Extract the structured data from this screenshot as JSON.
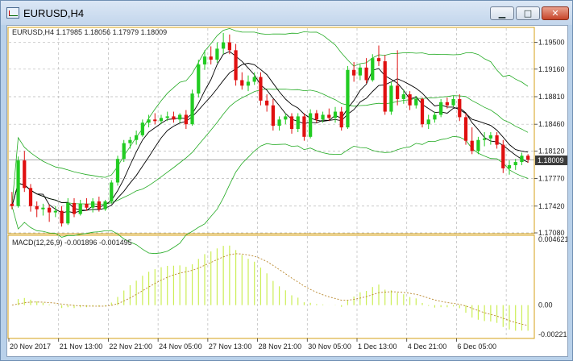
{
  "window": {
    "title": "EURUSD,H4",
    "buttons": {
      "minimize": "▁",
      "maximize": "□",
      "close": "✕"
    }
  },
  "colors": {
    "bull": "#22cc22",
    "bear": "#e01010",
    "bands": "#22aa22",
    "ma": "#000000",
    "grid": "#b8b8b8",
    "frame": "#d4a017",
    "macd_hist": "#ccee55",
    "macd_signal": "#b8862b"
  },
  "price_panel": {
    "header_label": "EURUSD,H4  1.17985 1.18056 1.17979 1.18009",
    "current_price": "1.18009",
    "price_ticks": [
      "1.19500",
      "1.19160",
      "1.18810",
      "1.18460",
      "1.18120",
      "1.17770",
      "1.17420",
      "1.17080"
    ]
  },
  "macd_panel": {
    "header_label": "MACD(12,26,9) -0.001896 -0.001495",
    "ticks": [
      "0.004621",
      "0.00",
      "-0.002213"
    ]
  },
  "time_axis": [
    "20 Nov 2017",
    "21 Nov 13:00",
    "22 Nov 21:00",
    "24 Nov 05:00",
    "27 Nov 13:00",
    "28 Nov 21:00",
    "30 Nov 05:00",
    "1 Dec 13:00",
    "4 Dec 21:00",
    "6 Dec 05:00"
  ],
  "chart_data": {
    "type": "candlestick",
    "symbol": "EURUSD",
    "timeframe": "H4",
    "ylim": [
      1.1708,
      1.1968
    ],
    "ohlc": [
      [
        1.1745,
        1.176,
        1.1738,
        1.1742
      ],
      [
        1.1742,
        1.1805,
        1.174,
        1.18
      ],
      [
        1.18,
        1.1812,
        1.176,
        1.1765
      ],
      [
        1.1765,
        1.177,
        1.1735,
        1.1742
      ],
      [
        1.1742,
        1.1748,
        1.1728,
        1.1738
      ],
      [
        1.1738,
        1.1745,
        1.173,
        1.174
      ],
      [
        1.174,
        1.1744,
        1.1722,
        1.1734
      ],
      [
        1.1734,
        1.1742,
        1.1728,
        1.1736
      ],
      [
        1.1736,
        1.1742,
        1.1716,
        1.172
      ],
      [
        1.172,
        1.1752,
        1.1718,
        1.1746
      ],
      [
        1.1746,
        1.1752,
        1.1728,
        1.1732
      ],
      [
        1.1732,
        1.175,
        1.173,
        1.1745
      ],
      [
        1.1745,
        1.1752,
        1.1736,
        1.174
      ],
      [
        1.174,
        1.1752,
        1.1734,
        1.1748
      ],
      [
        1.1748,
        1.1754,
        1.1735,
        1.1738
      ],
      [
        1.1738,
        1.175,
        1.1736,
        1.1748
      ],
      [
        1.1748,
        1.1775,
        1.1745,
        1.1772
      ],
      [
        1.1772,
        1.1806,
        1.1768,
        1.1802
      ],
      [
        1.1802,
        1.1826,
        1.1798,
        1.1822
      ],
      [
        1.1822,
        1.183,
        1.1815,
        1.1826
      ],
      [
        1.1826,
        1.1838,
        1.182,
        1.1832
      ],
      [
        1.1832,
        1.1852,
        1.183,
        1.1848
      ],
      [
        1.1848,
        1.1858,
        1.1842,
        1.1852
      ],
      [
        1.1852,
        1.186,
        1.1846,
        1.185
      ],
      [
        1.185,
        1.1858,
        1.1846,
        1.1854
      ],
      [
        1.1854,
        1.1862,
        1.185,
        1.1856
      ],
      [
        1.1856,
        1.1862,
        1.1848,
        1.1852
      ],
      [
        1.1852,
        1.186,
        1.1848,
        1.1858
      ],
      [
        1.1858,
        1.1864,
        1.184,
        1.1846
      ],
      [
        1.1846,
        1.189,
        1.1844,
        1.1885
      ],
      [
        1.1885,
        1.1928,
        1.188,
        1.1922
      ],
      [
        1.1922,
        1.194,
        1.1915,
        1.1932
      ],
      [
        1.1932,
        1.1945,
        1.1922,
        1.1928
      ],
      [
        1.1928,
        1.195,
        1.1924,
        1.1942
      ],
      [
        1.1942,
        1.1962,
        1.1935,
        1.195
      ],
      [
        1.195,
        1.196,
        1.1935,
        1.194
      ],
      [
        1.194,
        1.1948,
        1.1895,
        1.1902
      ],
      [
        1.1902,
        1.1912,
        1.189,
        1.1895
      ],
      [
        1.1895,
        1.1908,
        1.1888,
        1.19
      ],
      [
        1.19,
        1.1912,
        1.1896,
        1.1906
      ],
      [
        1.1906,
        1.1912,
        1.187,
        1.1876
      ],
      [
        1.1876,
        1.1884,
        1.1862,
        1.187
      ],
      [
        1.187,
        1.1878,
        1.1838,
        1.1844
      ],
      [
        1.1844,
        1.1856,
        1.1838,
        1.1852
      ],
      [
        1.1852,
        1.186,
        1.1846,
        1.1856
      ],
      [
        1.1856,
        1.186,
        1.1834,
        1.184
      ],
      [
        1.184,
        1.186,
        1.1836,
        1.1856
      ],
      [
        1.1856,
        1.186,
        1.1825,
        1.183
      ],
      [
        1.183,
        1.1865,
        1.1828,
        1.186
      ],
      [
        1.186,
        1.1864,
        1.1848,
        1.1852
      ],
      [
        1.1852,
        1.1862,
        1.1848,
        1.1858
      ],
      [
        1.1858,
        1.1866,
        1.185,
        1.1854
      ],
      [
        1.1854,
        1.1868,
        1.1848,
        1.1862
      ],
      [
        1.1862,
        1.1868,
        1.1838,
        1.1842
      ],
      [
        1.1842,
        1.192,
        1.184,
        1.1915
      ],
      [
        1.1915,
        1.1925,
        1.19,
        1.1908
      ],
      [
        1.1908,
        1.1922,
        1.1902,
        1.1918
      ],
      [
        1.1918,
        1.193,
        1.1898,
        1.1902
      ],
      [
        1.1902,
        1.1935,
        1.19,
        1.193
      ],
      [
        1.193,
        1.1946,
        1.192,
        1.1926
      ],
      [
        1.1926,
        1.1934,
        1.1858,
        1.1862
      ],
      [
        1.1862,
        1.19,
        1.1858,
        1.1895
      ],
      [
        1.1895,
        1.194,
        1.187,
        1.1878
      ],
      [
        1.1878,
        1.189,
        1.1872,
        1.1884
      ],
      [
        1.1884,
        1.1888,
        1.1864,
        1.187
      ],
      [
        1.187,
        1.1882,
        1.1866,
        1.1878
      ],
      [
        1.1878,
        1.188,
        1.1842,
        1.1846
      ],
      [
        1.1846,
        1.1858,
        1.184,
        1.1852
      ],
      [
        1.1852,
        1.1862,
        1.1848,
        1.1858
      ],
      [
        1.1858,
        1.1878,
        1.1855,
        1.1874
      ],
      [
        1.1874,
        1.188,
        1.1866,
        1.187
      ],
      [
        1.187,
        1.1882,
        1.1868,
        1.1878
      ],
      [
        1.1878,
        1.1884,
        1.185,
        1.1855
      ],
      [
        1.1855,
        1.186,
        1.182,
        1.1825
      ],
      [
        1.1825,
        1.1842,
        1.1808,
        1.1812
      ],
      [
        1.1812,
        1.183,
        1.1808,
        1.1826
      ],
      [
        1.1826,
        1.1836,
        1.1818,
        1.1828
      ],
      [
        1.1828,
        1.1836,
        1.182,
        1.1832
      ],
      [
        1.1832,
        1.1836,
        1.1815,
        1.182
      ],
      [
        1.182,
        1.1826,
        1.1784,
        1.179
      ],
      [
        1.179,
        1.18,
        1.1782,
        1.1794
      ],
      [
        1.1794,
        1.1802,
        1.1788,
        1.1798
      ],
      [
        1.1798,
        1.181,
        1.1794,
        1.1806
      ],
      [
        1.1806,
        1.1808,
        1.1797,
        1.1801
      ]
    ],
    "macd_histogram": [],
    "macd_signal_line": []
  }
}
